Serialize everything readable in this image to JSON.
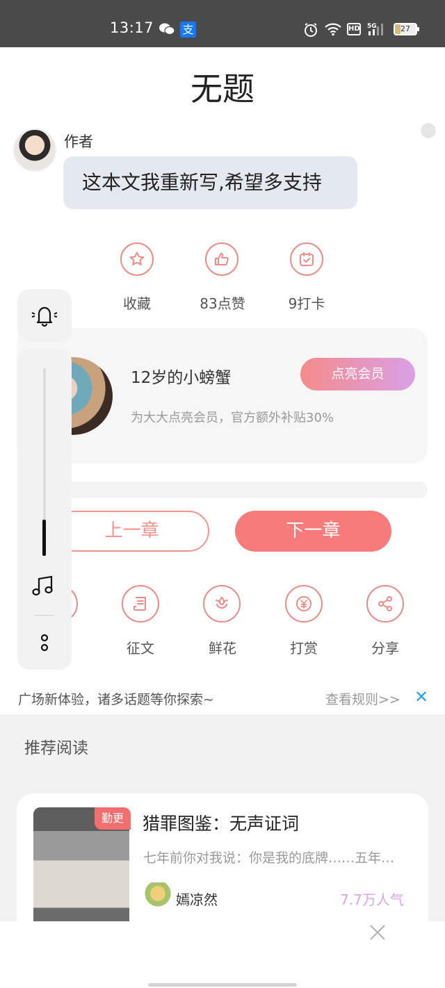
{
  "status_bar": {
    "time": "13:17",
    "alipay_glyph": "支",
    "hd": "HD",
    "network": "5G",
    "battery": "27"
  },
  "page": {
    "title": "无题"
  },
  "author_note": {
    "label": "作者",
    "message": "这本文我重新写,希望多支持"
  },
  "actions": [
    {
      "icon": "star-icon",
      "label": "收藏"
    },
    {
      "icon": "thumbs-up-icon",
      "label": "83点赞"
    },
    {
      "icon": "calendar-check-icon",
      "label": "9打卡"
    }
  ],
  "member": {
    "name": "12岁的小螃蟹",
    "description": "为大大点亮会员，官方额外补贴30%",
    "button": "点亮会员"
  },
  "navigation": {
    "prev": "上一章",
    "next": "下一章"
  },
  "tools": [
    {
      "icon": "scroll-icon",
      "label": "征文"
    },
    {
      "icon": "flower-icon",
      "label": "鲜花"
    },
    {
      "icon": "yen-coin-icon",
      "label": "打赏"
    },
    {
      "icon": "share-icon",
      "label": "分享"
    }
  ],
  "notice": {
    "text": "广场新体验，诸多话题等你探索~",
    "link": "查看规则>>",
    "close": "✕"
  },
  "recommend": {
    "title": "推荐阅读",
    "book": {
      "badge": "勤更",
      "title": "猎罪图鉴：无声证词",
      "description": "七年前你对我说：你是我的底牌……五年后，我成了你的底牌",
      "author": "嫣凉然",
      "popularity": "7.7万人气"
    }
  },
  "colors": {
    "accent": "#f77b7b",
    "outline": "#f08a84",
    "member_gradient": [
      "#f58b8b",
      "#d9a0e5"
    ],
    "close_blue": "#2aa2e8"
  }
}
